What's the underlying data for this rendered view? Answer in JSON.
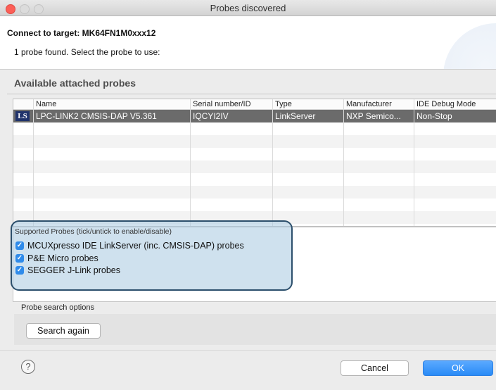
{
  "window": {
    "title": "Probes discovered"
  },
  "header": {
    "connect_label": "Connect to target: MK64FN1M0xxx12",
    "instruction": "1 probe found. Select the probe to use:"
  },
  "probes_section": {
    "title": "Available attached probes",
    "columns": [
      "Name",
      "Serial number/ID",
      "Type",
      "Manufacturer",
      "IDE Debug Mode"
    ],
    "rows": [
      {
        "icon_text": "LS",
        "icon_name": "linkserver-icon",
        "name": "LPC-LINK2 CMSIS-DAP V5.361",
        "serial": "IQCYI2IV",
        "type": "LinkServer",
        "manufacturer": "NXP Semico...",
        "debug_mode": "Non-Stop",
        "selected": true
      }
    ]
  },
  "supported_probes": {
    "title": "Supported Probes (tick/untick to enable/disable)",
    "items": [
      {
        "label": "MCUXpresso IDE LinkServer (inc. CMSIS-DAP) probes",
        "checked": true
      },
      {
        "label": "P&E Micro probes",
        "checked": true
      },
      {
        "label": "SEGGER J-Link probes",
        "checked": true
      }
    ]
  },
  "search_options": {
    "title": "Probe search options",
    "search_button": "Search again"
  },
  "footer": {
    "help_symbol": "?",
    "cancel_label": "Cancel",
    "ok_label": "OK"
  },
  "colors": {
    "selected_row": "#6b6b6b",
    "checkbox": "#2f8bea",
    "highlight_fill": "#a8c8e0",
    "highlight_border": "#2c4f6c",
    "ok_button": "#2a8bf6"
  }
}
